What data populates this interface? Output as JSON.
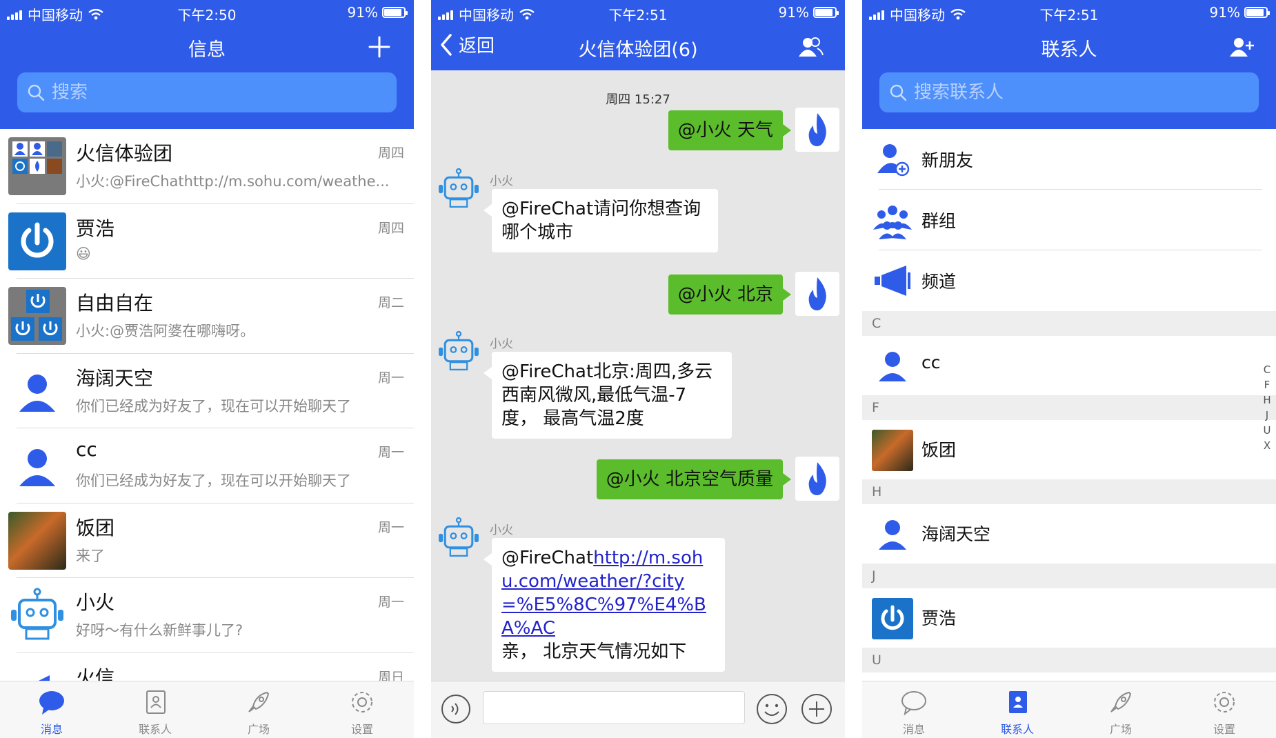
{
  "status": {
    "carrier": "中国移动",
    "battery": "91%",
    "battery_level": 0.91,
    "times": [
      "下午2:50",
      "下午2:51",
      "下午2:51"
    ]
  },
  "messages_screen": {
    "title": "信息",
    "search_placeholder": "搜索",
    "conversations": [
      {
        "name": "火信体验团",
        "time": "周四",
        "preview": "小火:@FireChathttp://m.sohu.com/weathe..."
      },
      {
        "name": "贾浩",
        "time": "周四",
        "preview": "😃"
      },
      {
        "name": "自由自在",
        "time": "周二",
        "preview": "小火:@贾浩阿婆在哪嗨呀。"
      },
      {
        "name": "海阔天空",
        "time": "周一",
        "preview": "你们已经成为好友了，现在可以开始聊天了"
      },
      {
        "name": "cc",
        "time": "周一",
        "preview": "你们已经成为好友了，现在可以开始聊天了"
      },
      {
        "name": "饭团",
        "time": "周一",
        "preview": "来了"
      },
      {
        "name": "小火",
        "time": "周一",
        "preview": "好呀～有什么新鲜事儿了?"
      },
      {
        "name": "火信",
        "time": "周日",
        "preview": ""
      }
    ]
  },
  "tabs": [
    {
      "label": "消息",
      "icon": "chat-bubble-icon"
    },
    {
      "label": "联系人",
      "icon": "contacts-book-icon"
    },
    {
      "label": "广场",
      "icon": "rocket-icon"
    },
    {
      "label": "设置",
      "icon": "gear-icon"
    }
  ],
  "chat_screen": {
    "back_label": "返回",
    "title": "火信体验团(6)",
    "timestamp": "周四 15:27",
    "sender_name": "小火",
    "msg1": "@小火 天气",
    "msg2": "@FireChat请问你想查询哪个城市",
    "msg3": "@小火 北京",
    "msg4": "@FireChat北京:周四,多云西南风微风,最低气温-7度， 最高气温2度",
    "msg5": "@小火 北京空气质量",
    "msg6_prefix": "@FireChat",
    "msg6_link": "http://m.sohu.com/weather/?city=%E5%8C%97%E4%BA%AC",
    "msg6_suffix": "亲， 北京天气情况如下"
  },
  "contacts_screen": {
    "title": "联系人",
    "search_placeholder": "搜索联系人",
    "functions": [
      "新朋友",
      "群组",
      "频道"
    ],
    "sections": [
      {
        "letter": "C",
        "contacts": [
          "cc"
        ]
      },
      {
        "letter": "F",
        "contacts": [
          "饭团"
        ]
      },
      {
        "letter": "H",
        "contacts": [
          "海阔天空"
        ]
      },
      {
        "letter": "J",
        "contacts": [
          "贾浩"
        ]
      },
      {
        "letter": "U",
        "contacts": []
      }
    ],
    "index_letters": [
      "C",
      "F",
      "H",
      "J",
      "U",
      "X"
    ]
  },
  "colors": {
    "brand_blue": "#2f5be9",
    "search_blue": "#4d90fb",
    "bubble_green": "#5bbd2b",
    "power_blue": "#1a73c8"
  }
}
